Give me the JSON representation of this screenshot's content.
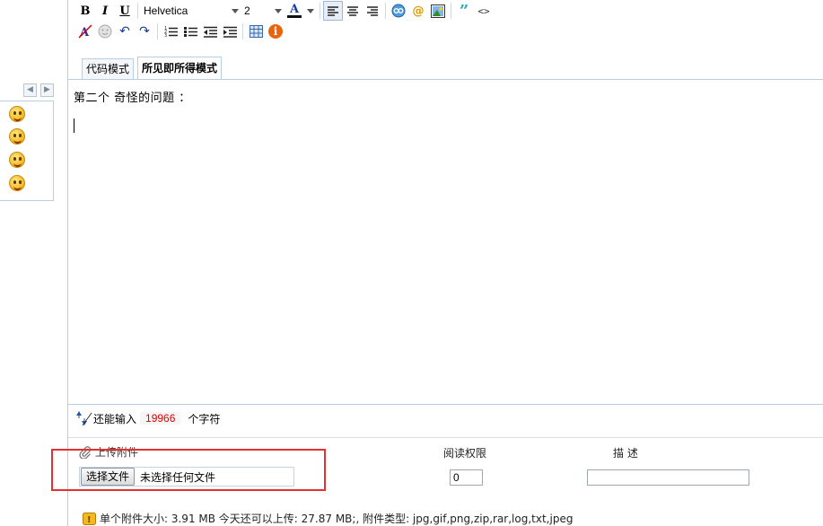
{
  "toolbar": {
    "bold": "B",
    "italic": "I",
    "underline": "U",
    "font_family": "Helvetica",
    "font_size": "2",
    "font_color_glyph": "A",
    "font_color": "#cc0000",
    "at_glyph": "@",
    "quote_glyph": "”",
    "code_glyph": "<>",
    "info_glyph": "i",
    "undo_glyph": "↶",
    "redo_glyph": "↷"
  },
  "tabs": [
    {
      "label": "代码模式",
      "active": false
    },
    {
      "label": "所见即所得模式",
      "active": true
    }
  ],
  "editor": {
    "content": "第二个  奇怪的问题 ："
  },
  "counter": {
    "prefix": "还能输入",
    "remaining": "19966",
    "suffix": "个字符"
  },
  "attachments": {
    "title": "上传附件",
    "col_permission": "阅读权限",
    "col_description": "描 述",
    "choose_button": "选择文件",
    "file_status": "未选择任何文件",
    "permission_value": "0",
    "description_value": ""
  },
  "info": {
    "text": "单个附件大小: 3.91 MB  今天还可以上传: 27.87 MB;,  附件类型: jpg,gif,png,zip,rar,log,txt,jpeg"
  },
  "colors": {
    "accent_border": "#b7cfe5",
    "highlight": "#e53030",
    "counter_number": "#e00000"
  }
}
